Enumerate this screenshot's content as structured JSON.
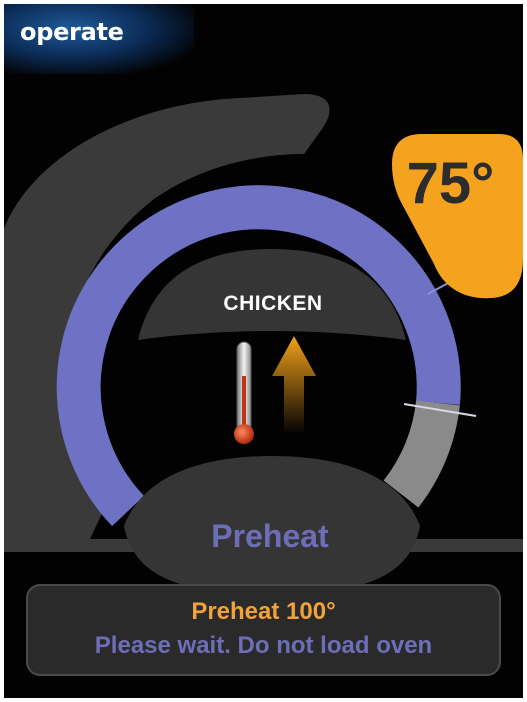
{
  "header": {
    "title": "operate"
  },
  "oven": {
    "current_temperature": "75°",
    "food": "CHICKEN",
    "mode": "Preheat",
    "preheat_progress_fraction": 0.82
  },
  "status": {
    "line1": "Preheat 100°",
    "line2": "Please wait. Do not load oven"
  },
  "icons": {
    "thermometer": "thermometer-icon",
    "rising": "up-arrow-icon"
  },
  "colors": {
    "progress": "#6f72c4",
    "remaining": "#8a8a8a",
    "temperature_badge": "#f5a21f",
    "status_primary": "#f2a23a",
    "status_secondary": "#6e6eb8",
    "panel": "#2f2f2f"
  }
}
